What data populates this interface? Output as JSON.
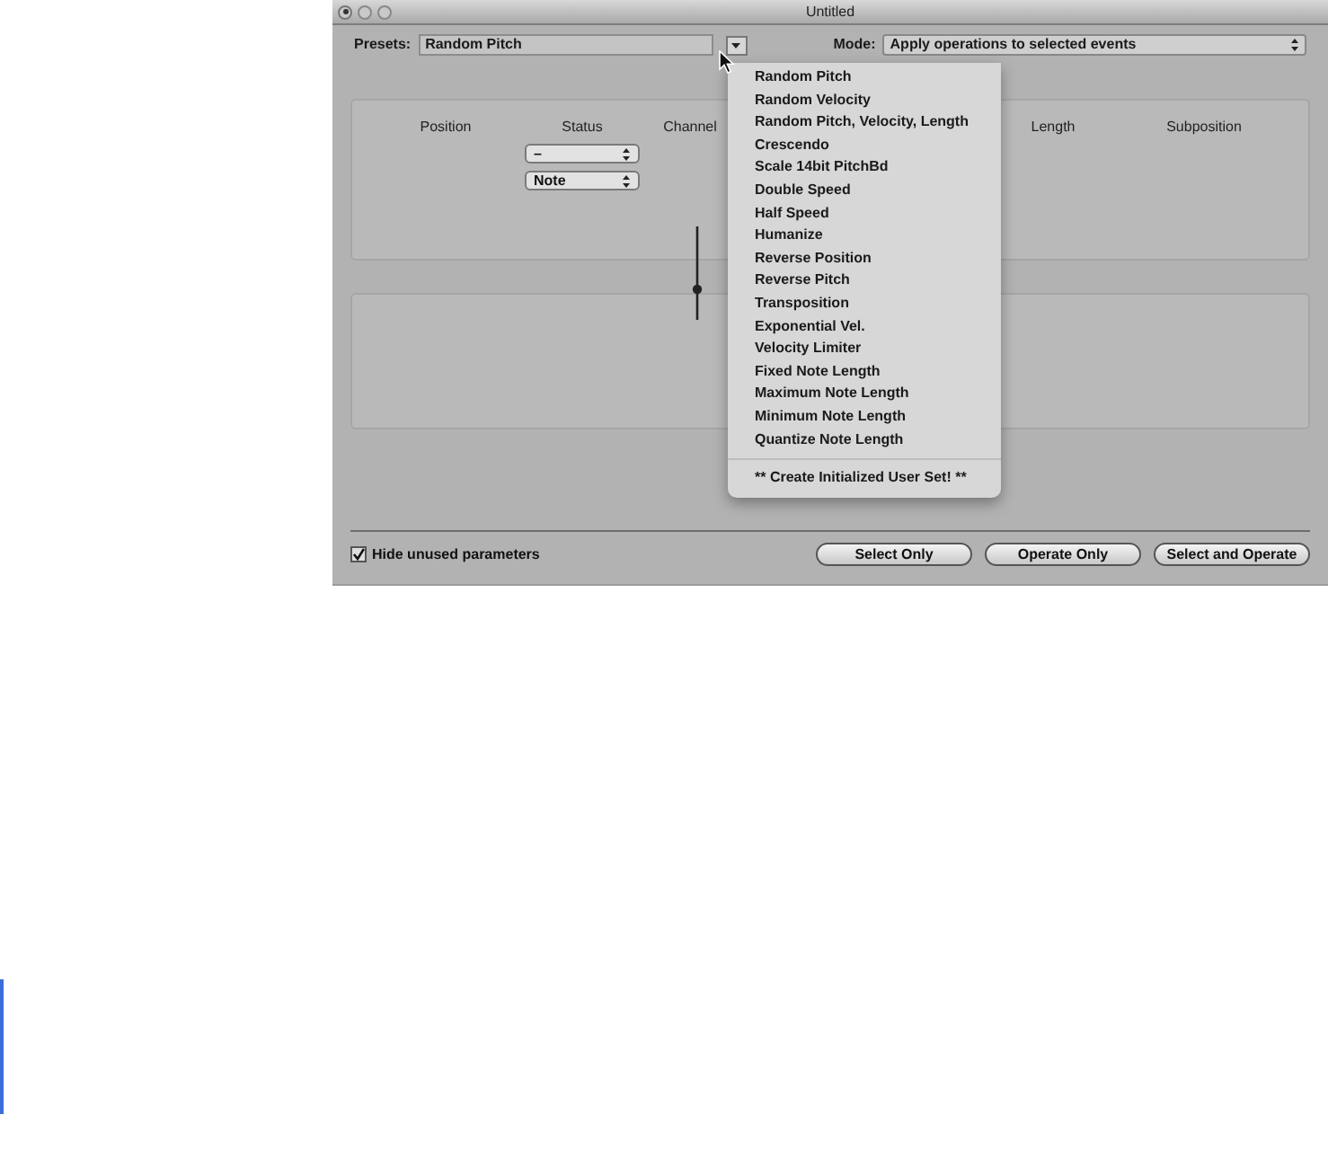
{
  "window": {
    "title": "Untitled"
  },
  "presets": {
    "label": "Presets:",
    "value": "Random Pitch"
  },
  "mode": {
    "label": "Mode:",
    "value": "Apply operations to selected events"
  },
  "columns": [
    "Position",
    "Status",
    "Channel",
    "Length",
    "Subposition"
  ],
  "status_selects": [
    "–",
    "Note"
  ],
  "hide_unused": {
    "label": "Hide unused parameters",
    "checked": true
  },
  "buttons": [
    "Select Only",
    "Operate Only",
    "Select and Operate"
  ],
  "presets_menu": {
    "items": [
      "Random Pitch",
      "Random Velocity",
      "Random Pitch, Velocity, Length",
      "Crescendo",
      "Scale 14bit PitchBd",
      "Double Speed",
      "Half Speed",
      "Humanize",
      "Reverse Position",
      "Reverse Pitch",
      "Transposition",
      "Exponential Vel.",
      "Velocity Limiter",
      "Fixed Note Length",
      "Maximum Note Length",
      "Minimum Note Length",
      "Quantize Note Length"
    ],
    "footer_item": "** Create Initialized User Set! **"
  }
}
